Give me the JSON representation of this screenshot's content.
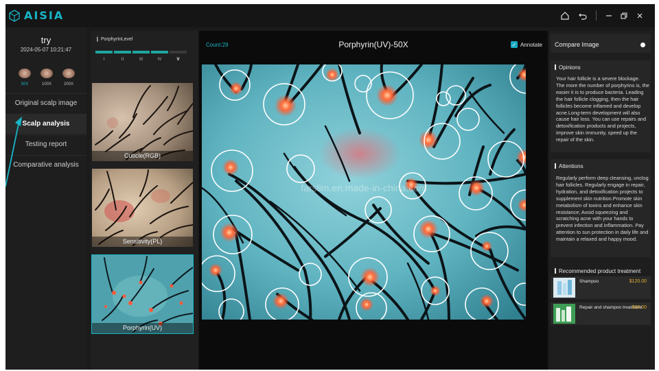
{
  "app": {
    "name": "AISIA"
  },
  "window": {
    "home": "home-icon",
    "back": "back-icon",
    "minimize": "minimize-icon",
    "restore": "restore-icon",
    "close": "close-icon"
  },
  "user": {
    "name": "try",
    "datetime": "2024-05-07 10:21:47"
  },
  "magnifications": [
    {
      "label": "50X",
      "active": true
    },
    {
      "label": "100X",
      "active": false
    },
    {
      "label": "200X",
      "active": false
    }
  ],
  "menu": [
    {
      "label": "Original scalp image",
      "active": false
    },
    {
      "label": "Scalp analysis",
      "active": true
    },
    {
      "label": "Testing report",
      "active": false
    },
    {
      "label": "Comparative analysis",
      "active": false
    }
  ],
  "level": {
    "title": "PorphyrinLevel",
    "labels": [
      "I",
      "II",
      "III",
      "IV",
      "V"
    ],
    "value": 4
  },
  "thumbnails": [
    {
      "label": "Cuticle(RGB)",
      "selected": false
    },
    {
      "label": "Sensitivity(PL)",
      "selected": false
    },
    {
      "label": "Porphyrin(UV)",
      "selected": true
    }
  ],
  "viewer": {
    "count": "Count:29",
    "title": "Porphyrin(UV)-50X",
    "annotate_label": "Annotate",
    "annotate_checked": true,
    "watermark": "farslim.en.made-in-china.com"
  },
  "compare": {
    "label": "Compare Image"
  },
  "opinions": {
    "title": "Opinions",
    "text": "Your hair follicle is a severe blockage. The more the number of porphyrins is, the easier it is to produce bacteria. Leading the hair follicle clogging, then the hair follicles become inflamed and develop acne.Long-term development will also cause hair loss. You can use repairs and detoxification products and projects, improve skin immunity, speed up the repair of the skin."
  },
  "attentions": {
    "title": "Attentions",
    "text": "Regularly perform deep cleansing, unclog hair follicles. Regularly engage in repair, hydration, and detoxification projects to supplement skin nutrition.Promote skin metabolism of toxins and enhance skin resistance; Avoid squeezing and scratching acne with your hands to prevent infection and inflammation. Pay attention to sun protection in daily life and maintain a relaxed and happy mood."
  },
  "products": {
    "title": "Recommended product treatment",
    "items": [
      {
        "name": "Shampoo",
        "price": "$120.00"
      },
      {
        "name": "Repair and shampoo treatment",
        "price": "$99.00"
      }
    ]
  },
  "colors": {
    "accent": "#17b6c7",
    "price": "#e3b234",
    "level": "#1fa5a0"
  }
}
